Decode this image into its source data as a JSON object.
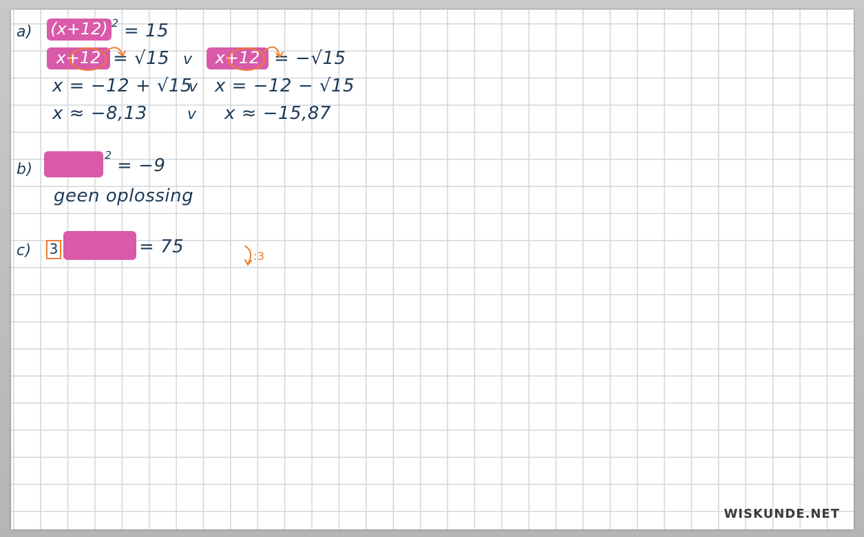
{
  "part_a": {
    "label": "a)",
    "line1": {
      "highlight": "(x+12)",
      "exponent": "2",
      "rest": "= 15"
    },
    "line2_left": {
      "highlight": "x+12",
      "rest": "= √15"
    },
    "line2_or": "v",
    "line2_right": {
      "highlight": "x+12",
      "rest": "= −√15"
    },
    "line3_left": "x = −12 + √15",
    "line3_or": "v",
    "line3_right": "x = −12 − √15",
    "line4_left": "x ≈ −8,13",
    "line4_or": "v",
    "line4_right": "x ≈ −15,87"
  },
  "part_b": {
    "label": "b)",
    "exponent": "2",
    "rest": "= −9",
    "line2": "geen oplossing"
  },
  "part_c": {
    "label": "c)",
    "boxed": "3",
    "rest": "= 75",
    "annotation": ":3"
  },
  "watermark": "WISKUNDE.NET",
  "colors": {
    "ink": "#1c3a57",
    "highlight": "#d95aa9",
    "annotation": "#ee7d2e",
    "grid": "#d2d6da"
  }
}
